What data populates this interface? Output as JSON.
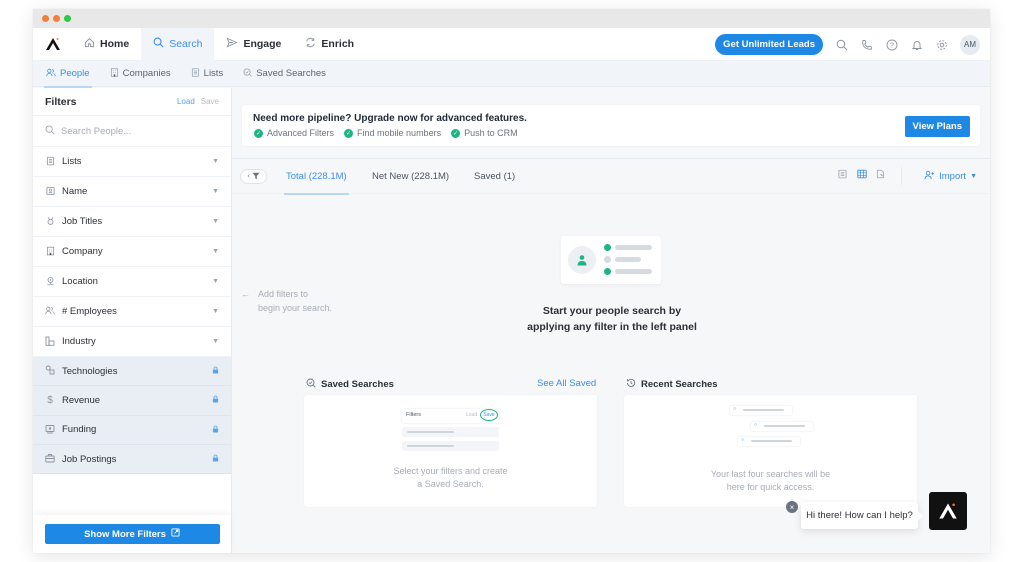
{
  "window": {
    "controls": [
      {
        "name": "close",
        "color": "#f0803c"
      },
      {
        "name": "minimize",
        "color": "#f0803c"
      },
      {
        "name": "maximize",
        "color": "#2bc840"
      }
    ]
  },
  "topnav": {
    "logo": "apollo-logo",
    "items": [
      {
        "label": "Home",
        "icon": "home-icon",
        "active": false
      },
      {
        "label": "Search",
        "icon": "search-icon",
        "active": true
      },
      {
        "label": "Engage",
        "icon": "send-icon",
        "active": false
      },
      {
        "label": "Enrich",
        "icon": "refresh-icon",
        "active": false
      }
    ],
    "cta_label": "Get Unlimited Leads",
    "icons": [
      "search-icon",
      "phone-icon",
      "help-icon",
      "bell-icon",
      "gear-icon"
    ],
    "avatar_initials": "AM"
  },
  "subnav": {
    "items": [
      {
        "label": "People",
        "icon": "people-icon",
        "active": true
      },
      {
        "label": "Companies",
        "icon": "building-icon",
        "active": false
      },
      {
        "label": "Lists",
        "icon": "list-icon",
        "active": false
      },
      {
        "label": "Saved Searches",
        "icon": "saved-search-icon",
        "active": false
      }
    ]
  },
  "sidebar": {
    "title": "Filters",
    "load_label": "Load",
    "save_label": "Save",
    "search_placeholder": "Search People...",
    "filters": [
      {
        "label": "Lists",
        "icon": "list-icon",
        "locked": false
      },
      {
        "label": "Name",
        "icon": "id-badge-icon",
        "locked": false
      },
      {
        "label": "Job Titles",
        "icon": "job-title-icon",
        "locked": false
      },
      {
        "label": "Company",
        "icon": "building-icon",
        "locked": false
      },
      {
        "label": "Location",
        "icon": "location-pin-icon",
        "locked": false
      },
      {
        "label": "# Employees",
        "icon": "people-icon",
        "locked": false
      },
      {
        "label": "Industry",
        "icon": "industry-icon",
        "locked": false
      },
      {
        "label": "Technologies",
        "icon": "technologies-icon",
        "locked": true
      },
      {
        "label": "Revenue",
        "icon": "dollar-icon",
        "locked": true
      },
      {
        "label": "Funding",
        "icon": "funding-icon",
        "locked": true
      },
      {
        "label": "Job Postings",
        "icon": "briefcase-icon",
        "locked": true
      }
    ],
    "show_more_label": "Show More Filters"
  },
  "banner": {
    "title": "Need more pipeline? Upgrade now for advanced features.",
    "features": [
      "Advanced Filters",
      "Find mobile numbers",
      "Push to CRM"
    ],
    "button_label": "View Plans",
    "check_color": "#1db584"
  },
  "results_tabs": {
    "tabs": [
      {
        "label": "Total (228.1M)",
        "active": true
      },
      {
        "label": "Net New (228.1M)",
        "active": false
      },
      {
        "label": "Saved (1)",
        "active": false
      }
    ],
    "view_icons": [
      "list-view-icon",
      "table-view-icon",
      "export-icon"
    ],
    "import_label": "Import"
  },
  "empty_state": {
    "hint_line1": "Add filters to",
    "hint_line2": "begin your search.",
    "title_line1": "Start your people search by",
    "title_line2": "applying any filter in the left panel"
  },
  "saved_searches": {
    "title": "Saved Searches",
    "link_label": "See All Saved",
    "illus_title": "Filters",
    "illus_load": "Load",
    "illus_save": "Save",
    "text_line1": "Select your filters and create",
    "text_line2": "a Saved Search."
  },
  "recent_searches": {
    "title": "Recent Searches",
    "text_line1": "Your last four searches will be",
    "text_line2": "here for quick access."
  },
  "chat": {
    "message": "Hi there! How can I help?"
  },
  "colors": {
    "accent": "#1e88e5",
    "link": "#3b8ee8",
    "success": "#1db584"
  }
}
